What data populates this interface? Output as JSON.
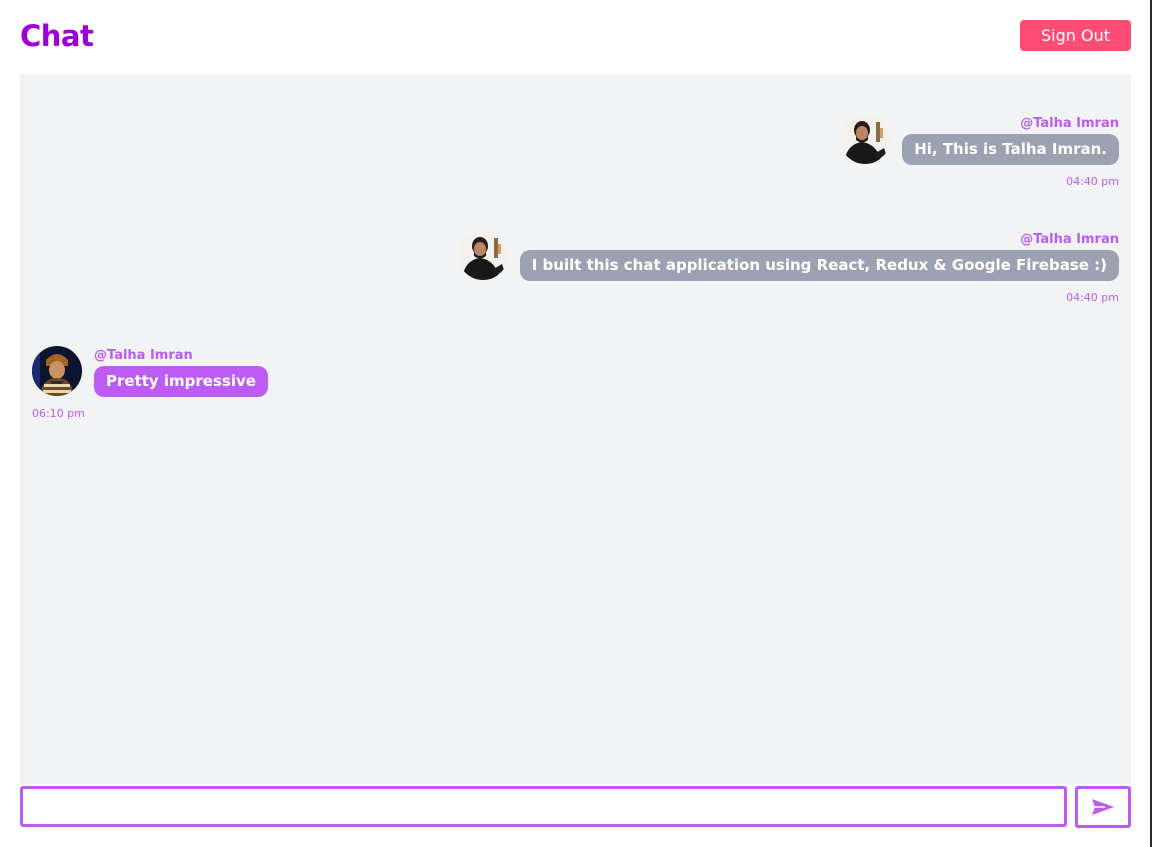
{
  "app": {
    "title": "Chat",
    "sign_out_label": "Sign Out"
  },
  "colors": {
    "brand": "#9b00d6",
    "accent": "#bd5cf3",
    "sign_out": "#ff4d73",
    "outgoing_bubble": "#9ca2b1",
    "incoming_bubble": "#bd5cf3",
    "chat_background": "#f2f3f5"
  },
  "messages": [
    {
      "username": "@Talha Imran",
      "text": "Hi, This is Talha Imran.",
      "time": "04:40 pm",
      "side": "right",
      "avatar": "user-photo-avatar"
    },
    {
      "username": "@Talha Imran",
      "text": "I built this chat application using React, Redux & Google Firebase :)",
      "time": "04:40 pm",
      "side": "right",
      "avatar": "user-photo-avatar"
    },
    {
      "username": "@Talha Imran",
      "text": "Pretty impressive",
      "time": "06:10 pm",
      "side": "left",
      "avatar": "user-photo-avatar"
    }
  ],
  "composer": {
    "input_value": "",
    "placeholder": "",
    "send_icon": "send-icon"
  }
}
